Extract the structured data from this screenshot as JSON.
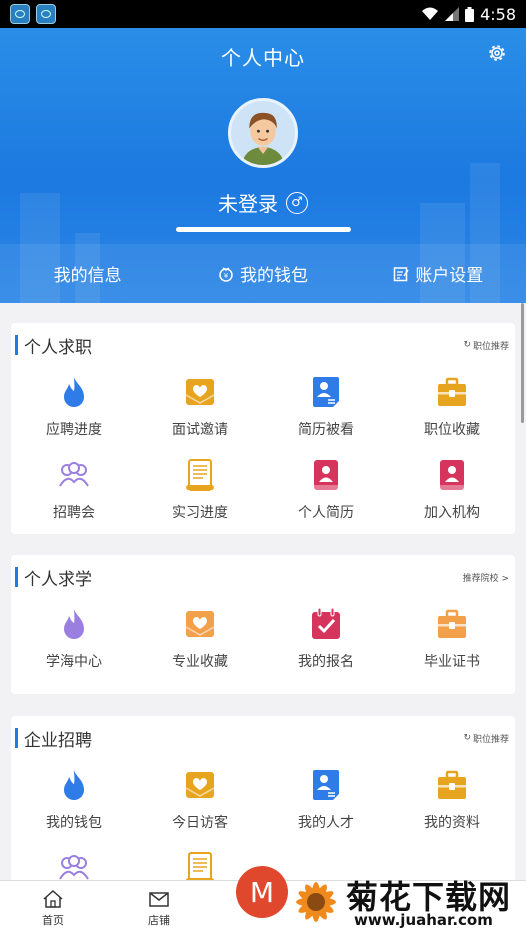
{
  "status_bar": {
    "time": "4:58"
  },
  "header": {
    "title": "个人中心",
    "username": "未登录",
    "gender_symbol": "♂",
    "nav": [
      {
        "label": "我的信息",
        "icon": "none"
      },
      {
        "label": "我的钱包",
        "icon": "wallet-icon"
      },
      {
        "label": "账户设置",
        "icon": "edit-icon"
      }
    ]
  },
  "sections": [
    {
      "title": "个人求职",
      "more": "职位推荐",
      "items": [
        {
          "label": "应聘进度",
          "icon": "flame-icon",
          "color": "#2f7be8"
        },
        {
          "label": "面试邀请",
          "icon": "heart-letter-icon",
          "color": "#e7a51f"
        },
        {
          "label": "简历被看",
          "icon": "resume-card-icon",
          "color": "#2f7be8"
        },
        {
          "label": "职位收藏",
          "icon": "briefcase-icon",
          "color": "#e7a51f"
        },
        {
          "label": "招聘会",
          "icon": "group-icon",
          "color": "#9b7fe0"
        },
        {
          "label": "实习进度",
          "icon": "scroll-icon",
          "color": "#e7a51f"
        },
        {
          "label": "个人简历",
          "icon": "profile-book-icon",
          "color": "#d6335d"
        },
        {
          "label": "加入机构",
          "icon": "profile-book-icon",
          "color": "#d6335d"
        }
      ]
    },
    {
      "title": "个人求学",
      "more": "推荐院校 >",
      "items": [
        {
          "label": "学海中心",
          "icon": "flame-icon",
          "color": "#9b7fe0"
        },
        {
          "label": "专业收藏",
          "icon": "heart-letter-icon",
          "color": "#f2a04a"
        },
        {
          "label": "我的报名",
          "icon": "calendar-check-icon",
          "color": "#d6335d"
        },
        {
          "label": "毕业证书",
          "icon": "briefcase-icon",
          "color": "#f2a04a"
        }
      ]
    },
    {
      "title": "企业招聘",
      "more": "职位推荐",
      "items": [
        {
          "label": "我的钱包",
          "icon": "flame-icon",
          "color": "#2f7be8"
        },
        {
          "label": "今日访客",
          "icon": "heart-letter-icon",
          "color": "#e7a51f"
        },
        {
          "label": "我的人才",
          "icon": "resume-card-icon",
          "color": "#2f7be8"
        },
        {
          "label": "我的资料",
          "icon": "briefcase-icon",
          "color": "#e7a51f"
        },
        {
          "label": "",
          "icon": "group-icon",
          "color": "#9b7fe0"
        },
        {
          "label": "",
          "icon": "scroll-icon",
          "color": "#e7a51f"
        }
      ]
    }
  ],
  "tabbar": [
    {
      "label": "首页",
      "icon": "home-icon"
    },
    {
      "label": "店铺",
      "icon": "mail-icon"
    }
  ],
  "watermark": {
    "badge": "M",
    "title": "菊花下载网",
    "url": "www.juahar.com"
  }
}
